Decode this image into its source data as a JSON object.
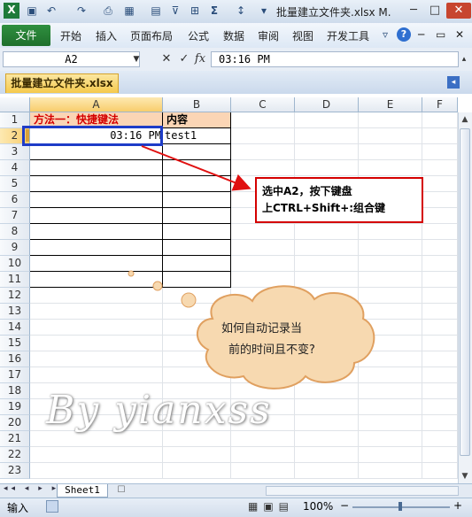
{
  "window": {
    "title": "批量建立文件夹.xlsx M.",
    "qat_icons": [
      "excel-logo-icon",
      "save-icon",
      "undo-icon",
      "redo-icon",
      "print-preview-icon",
      "layout-icon",
      "calculator-icon",
      "filter-icon",
      "border-icon",
      "sum-icon",
      "sort-icon",
      "customize-qat-icon"
    ],
    "qat_glyphs": [
      "X",
      "▣",
      "↶",
      "↷",
      "⎙",
      "▦",
      "▤",
      "⊽",
      "⊞",
      "Σ",
      "↕",
      "▾"
    ],
    "controls": {
      "minimize": "─",
      "maximize": "□",
      "close": "✕"
    }
  },
  "ribbon": {
    "file_tab": "文件",
    "tabs": [
      "开始",
      "插入",
      "页面布局",
      "公式",
      "数据",
      "审阅",
      "视图",
      "开发工具"
    ],
    "right_icons": {
      "collapse": "▿",
      "help": "?",
      "minimize": "─",
      "restore": "▭",
      "close": "✕"
    }
  },
  "formula_bar": {
    "name_box": "A2",
    "cancel_glyph": "✕",
    "enter_glyph": "✓",
    "fx_label": "fx",
    "content": "03:16 PM"
  },
  "document_tab": {
    "label": "批量建立文件夹.xlsx"
  },
  "grid": {
    "column_headers": [
      "A",
      "B",
      "C",
      "D",
      "E",
      "F"
    ],
    "row_headers": [
      "1",
      "2",
      "3",
      "4",
      "5",
      "6",
      "7",
      "8",
      "9",
      "10",
      "11",
      "12",
      "13",
      "14",
      "15",
      "16",
      "17",
      "18",
      "19",
      "20",
      "21",
      "22",
      "23"
    ],
    "cells": {
      "A1": "方法一：快捷键法",
      "B1": "内容",
      "A2": "03:16 PM",
      "B2": "test1"
    }
  },
  "callout": {
    "line1": "选中A2，按下键盘",
    "line2": "上CTRL+Shift+:组合键"
  },
  "cloud": {
    "line1": "如何自动记录当",
    "line2": "前的时间且不变?"
  },
  "watermark": "By yianxss",
  "sheet_tabs": {
    "active": "Sheet1"
  },
  "status_bar": {
    "mode": "输入",
    "zoom": "100%",
    "zoom_minus": "−",
    "zoom_plus": "+"
  },
  "colors": {
    "file_tab": "#1f6f2c",
    "header_fill": "#fbd5b5",
    "red_text": "#d40000",
    "selection": "#1e3cc8"
  }
}
